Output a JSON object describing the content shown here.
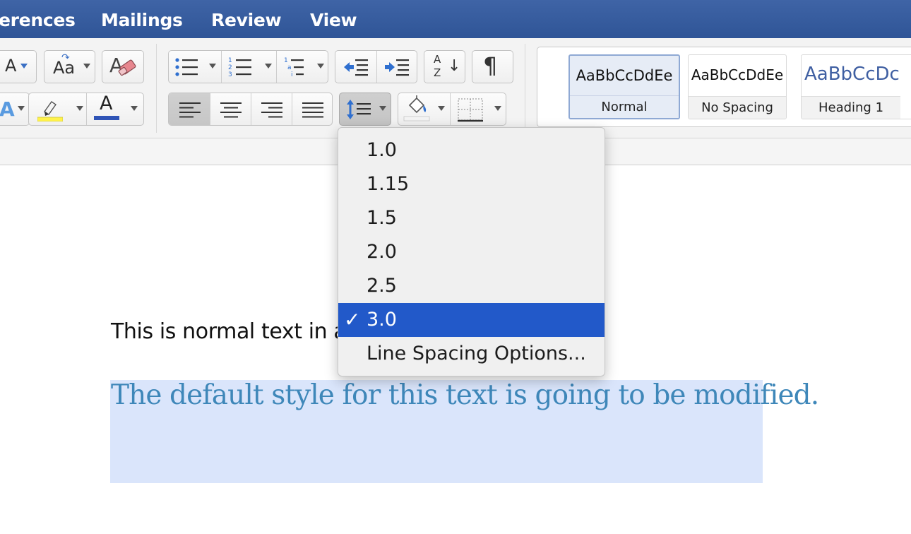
{
  "tabs": [
    "erences",
    "Mailings",
    "Review",
    "View"
  ],
  "ribbon": {
    "font_size_button": "A",
    "change_case_button": "Aa",
    "clear_format_letter": "A",
    "font_color_letter": "A",
    "highlight_color": "#fff24a",
    "font_color": "#2f54b6",
    "sort_letters": [
      "A",
      "Z"
    ],
    "show_marks": "¶",
    "numbered_list_digits": [
      "1",
      "2",
      "3"
    ],
    "multilevel_marks": [
      "1",
      "a",
      "i"
    ]
  },
  "styles": [
    {
      "preview": "AaBbCcDdEe",
      "label": "Normal",
      "selected": true
    },
    {
      "preview": "AaBbCcDdEe",
      "label": "No Spacing",
      "selected": false
    },
    {
      "preview": "AaBbCcDc",
      "label": "Heading 1",
      "selected": false
    }
  ],
  "line_spacing_menu": {
    "items": [
      "1.0",
      "1.15",
      "1.5",
      "2.0",
      "2.5",
      "3.0",
      "Line Spacing Options..."
    ],
    "selected": "3.0",
    "check_mark": "✓"
  },
  "document": {
    "normal_text": "This is normal text in a",
    "styled_text": "The default style for this text is going to be modified."
  },
  "colors": {
    "tab_bar": "#2f5597",
    "menu_highlight": "#2259c9",
    "styled_text": "#3e87b9",
    "selection": "#dae5fb",
    "heading_preview": "#3f5fa2"
  }
}
